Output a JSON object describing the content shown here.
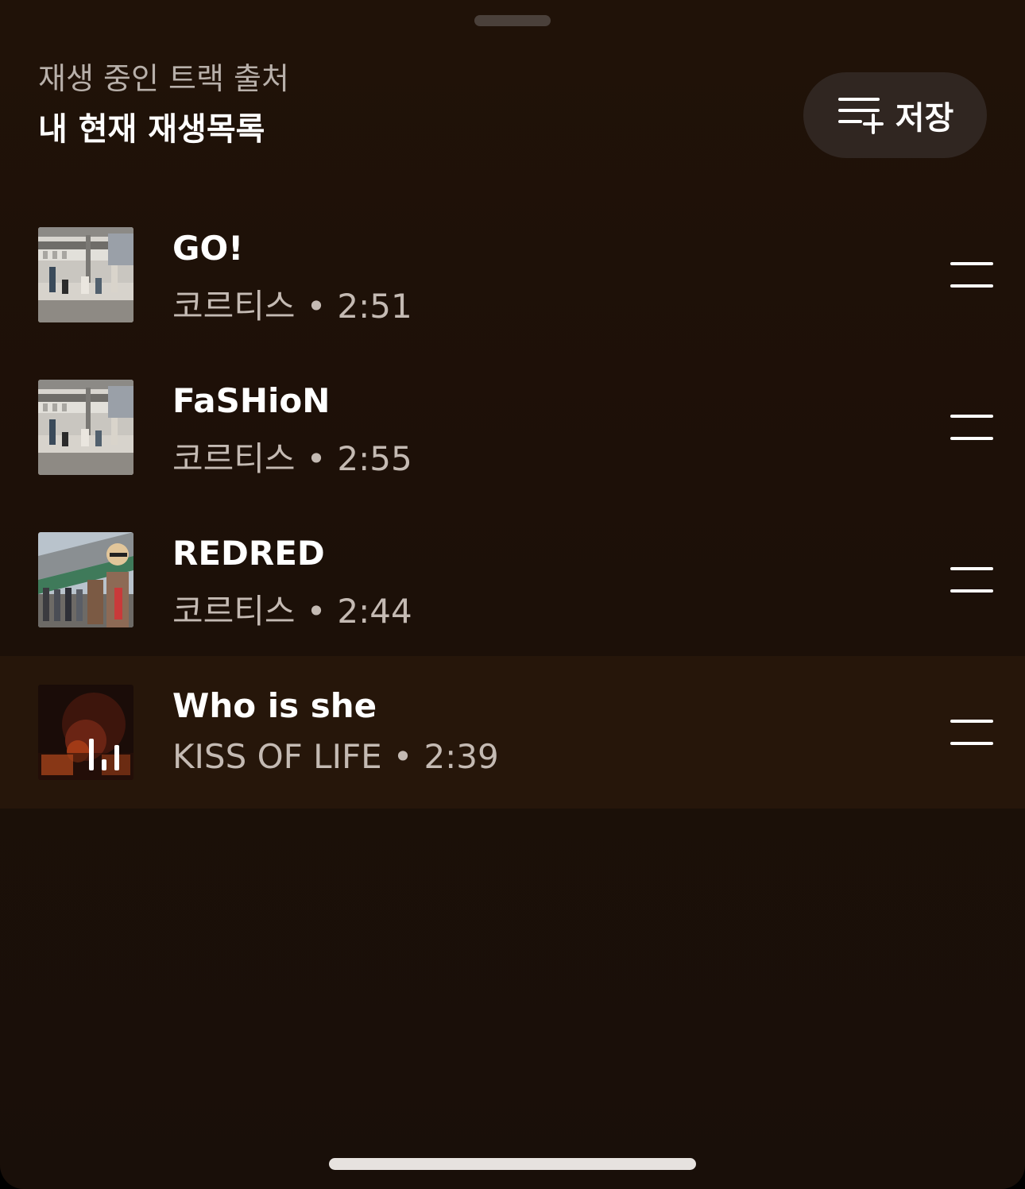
{
  "header": {
    "source_label": "재생 중인 트랙 출처",
    "source_name": "내 현재 재생목록",
    "save_label": "저장",
    "save_icon": "playlist-add-icon"
  },
  "tracks": [
    {
      "title": "GO!",
      "artist": "코르티스",
      "separator": "•",
      "duration": "2:51",
      "artwork": "cortis-street-album-art",
      "playing": false
    },
    {
      "title": "FaSHioN",
      "artist": "코르티스",
      "separator": "•",
      "duration": "2:55",
      "artwork": "cortis-street-album-art",
      "playing": false
    },
    {
      "title": "REDRED",
      "artist": "코르티스",
      "separator": "•",
      "duration": "2:44",
      "artwork": "cortis-redred-album-art",
      "playing": false
    },
    {
      "title": "Who is she",
      "artist": "KISS OF LIFE",
      "separator": "•",
      "duration": "2:39",
      "artwork": "kiss-of-life-album-art",
      "playing": true
    }
  ],
  "colors": {
    "background": "#1d1008",
    "playing_row": "#26160a",
    "save_button": "#302621",
    "secondary_text": "#c4bab3"
  }
}
